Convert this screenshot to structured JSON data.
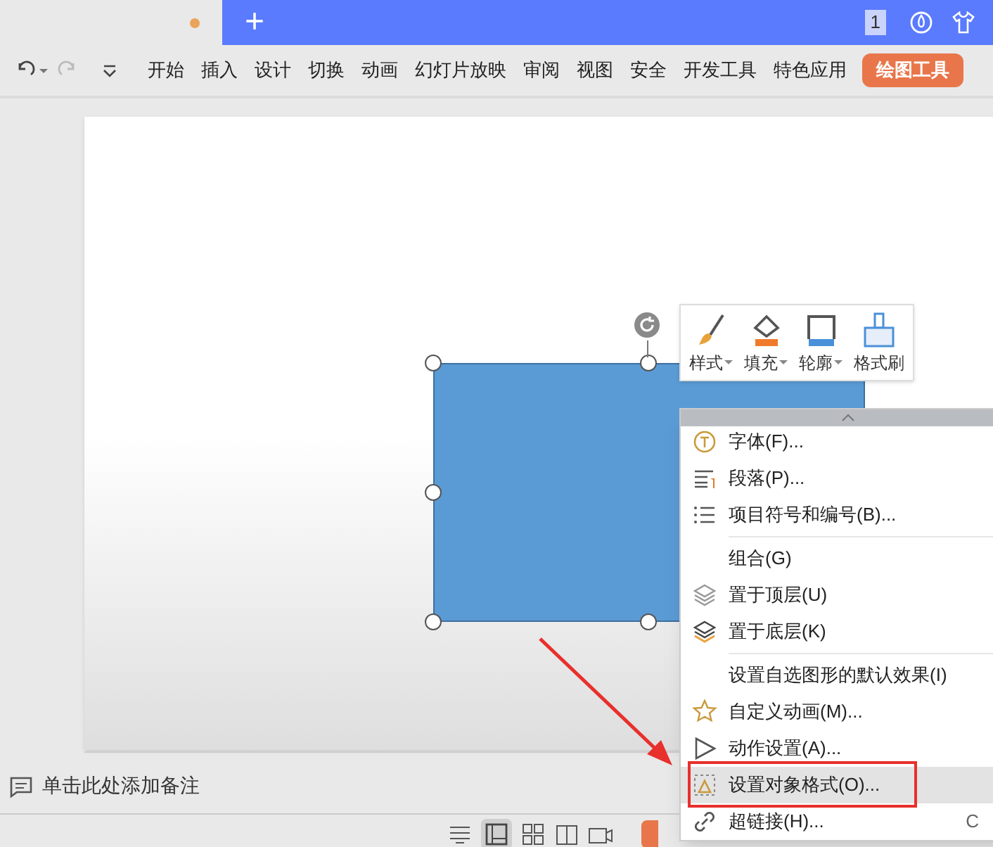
{
  "tab_bar": {
    "new_tab": "+",
    "counter": "1"
  },
  "ribbon": {
    "tabs": [
      {
        "label": "开始",
        "selected": false
      },
      {
        "label": "插入",
        "selected": false
      },
      {
        "label": "设计",
        "selected": false
      },
      {
        "label": "切换",
        "selected": false
      },
      {
        "label": "动画",
        "selected": false
      },
      {
        "label": "幻灯片放映",
        "selected": false
      },
      {
        "label": "审阅",
        "selected": false
      },
      {
        "label": "视图",
        "selected": false
      },
      {
        "label": "安全",
        "selected": false
      },
      {
        "label": "开发工具",
        "selected": false
      },
      {
        "label": "特色应用",
        "selected": false
      },
      {
        "label": "绘图工具",
        "selected": true
      }
    ]
  },
  "mini_toolbar": [
    {
      "label": "样式",
      "dropdown": true
    },
    {
      "label": "填充",
      "dropdown": true
    },
    {
      "label": "轮廓",
      "dropdown": true
    },
    {
      "label": "格式刷",
      "dropdown": false
    }
  ],
  "context_menu": [
    {
      "label": "字体(F)...",
      "selected": false,
      "separator_after": false
    },
    {
      "label": "段落(P)...",
      "selected": false,
      "separator_after": false
    },
    {
      "label": "项目符号和编号(B)...",
      "selected": false,
      "separator_after": true
    },
    {
      "label": "组合(G)",
      "selected": false,
      "separator_after": false
    },
    {
      "label": "置于顶层(U)",
      "selected": false,
      "separator_after": false
    },
    {
      "label": "置于底层(K)",
      "selected": false,
      "separator_after": true
    },
    {
      "label": "设置自选图形的默认效果(I)",
      "selected": false,
      "separator_after": false
    },
    {
      "label": "自定义动画(M)...",
      "selected": false,
      "separator_after": false
    },
    {
      "label": "动作设置(A)...",
      "selected": false,
      "separator_after": false
    },
    {
      "label": "设置对象格式(O)...",
      "selected": true,
      "separator_after": false
    },
    {
      "label": "超链接(H)...",
      "selected": false,
      "separator_after": false,
      "shortcut": "C"
    }
  ],
  "notes": {
    "placeholder": "单击此处添加备注"
  }
}
